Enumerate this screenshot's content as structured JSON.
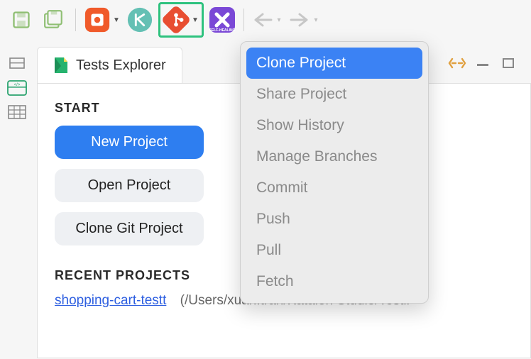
{
  "toolbar": {
    "save_icon": "save-icon",
    "save_all_icon": "save-all-icon",
    "record_icon": "record-icon",
    "katalon_icon": "katalon-icon",
    "git_icon": "git-icon",
    "selfheal_icon": "self-healing-icon",
    "selfheal_label": "SELF-HEALING"
  },
  "rail": {
    "outline_icon": "outline-icon",
    "tests_icon": "tests-tree-icon",
    "table_icon": "table-icon"
  },
  "tab": {
    "title": "Tests Explorer"
  },
  "panel": {
    "start_label": "START",
    "new_project": "New Project",
    "open_project": "Open Project",
    "clone_git_project": "Clone Git Project",
    "recent_label": "RECENT PROJECTS",
    "recent_link": "shopping-cart-testt",
    "recent_path": "(/Users/xuan.tran/Katalon Studio/Testir"
  },
  "git_menu": {
    "items": [
      {
        "label": "Clone Project",
        "enabled": true
      },
      {
        "label": "Share Project",
        "enabled": false
      },
      {
        "label": "Show History",
        "enabled": false
      },
      {
        "label": "Manage Branches",
        "enabled": false
      },
      {
        "label": "Commit",
        "enabled": false
      },
      {
        "label": "Push",
        "enabled": false
      },
      {
        "label": "Pull",
        "enabled": false
      },
      {
        "label": "Fetch",
        "enabled": false
      }
    ]
  }
}
